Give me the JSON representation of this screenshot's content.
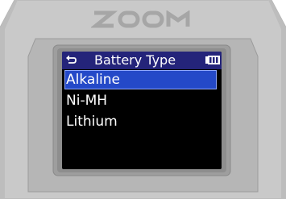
{
  "device": {
    "brand": "ZOOM",
    "colors": {
      "body": "#c7c7c7",
      "bezel": "#a9a9a9",
      "screen_bg": "#000000",
      "titlebar_bg": "#24247a",
      "selected_bg": "#2449c8",
      "text": "#ffffff"
    }
  },
  "screen": {
    "title": "Battery Type",
    "back_icon": "back-arrow-icon",
    "status_icon": "battery-full-icon",
    "menu": {
      "items": [
        {
          "label": "Alkaline",
          "selected": true
        },
        {
          "label": "Ni-MH",
          "selected": false
        },
        {
          "label": "Lithium",
          "selected": false
        }
      ]
    }
  }
}
